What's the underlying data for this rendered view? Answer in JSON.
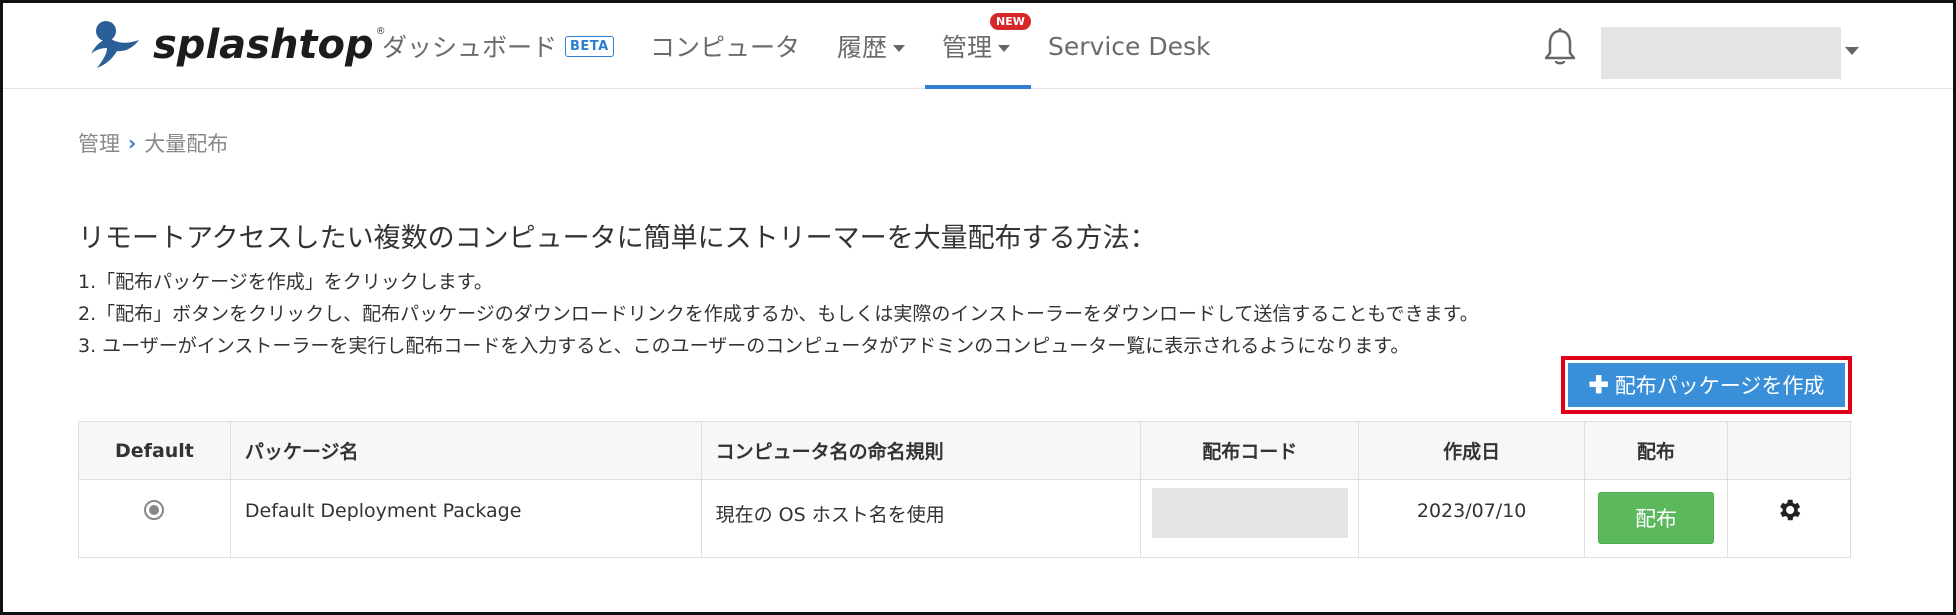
{
  "brand": {
    "name": "splashtop",
    "reg_mark": "®",
    "icon": "splashtop-logo-icon"
  },
  "nav": {
    "dashboard": "ダッシュボード",
    "dashboard_badge": "BETA",
    "computers": "コンピュータ",
    "history": "履歴",
    "manage": "管理",
    "manage_badge": "NEW",
    "service_desk": "Service Desk"
  },
  "header_icons": {
    "bell": "bell-icon"
  },
  "breadcrumb": {
    "parent": "管理",
    "current": "大量配布"
  },
  "heading": "リモートアクセスしたい複数のコンピュータに簡単にストリーマーを大量配布する方法：",
  "steps": [
    "1.「配布パッケージを作成」をクリックします。",
    "2.「配布」ボタンをクリックし、配布パッケージのダウンロードリンクを作成するか、もしくは実際のインストーラーをダウンロードして送信することもできます。",
    "3. ユーザーがインストーラーを実行し配布コードを入力すると、このユーザーのコンピュータがアドミンのコンピューター覧に表示されるようになります。"
  ],
  "create_button": {
    "icon": "plus-icon",
    "label": "配布パッケージを作成"
  },
  "table": {
    "headers": [
      "Default",
      "パッケージ名",
      "コンピュータ名の命名規則",
      "配布コード",
      "作成日",
      "配布",
      ""
    ],
    "rows": [
      {
        "default_selected": true,
        "package_name": "Default Deployment Package",
        "naming_rule": "現在の OS ホスト名を使用",
        "created": "2023/07/10",
        "deploy_label": "配布",
        "settings_icon": "gear-icon"
      }
    ]
  },
  "colors": {
    "accent": "#2f7fd1",
    "button_blue": "#3a8fd9",
    "deploy_green": "#5cb85c",
    "badge_red": "#d62828",
    "highlight_red": "#e0001a"
  }
}
